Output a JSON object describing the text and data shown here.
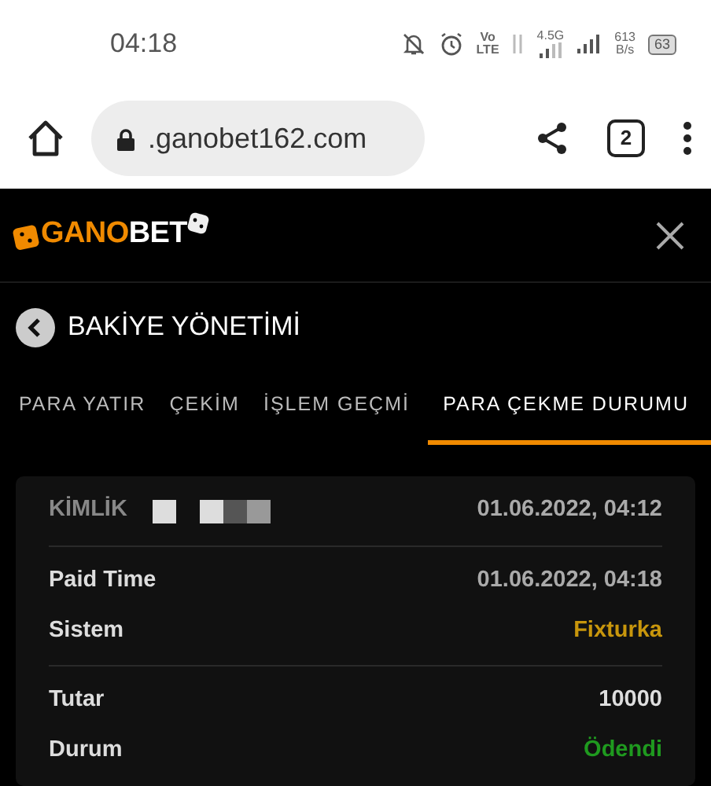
{
  "status_bar": {
    "time": "04:18",
    "volte": [
      "Vo",
      "LTE"
    ],
    "network": "4.5G",
    "speed": [
      "613",
      "B/s"
    ],
    "battery": "63"
  },
  "browser": {
    "url": ".ganobet162.com",
    "tab_count": "2"
  },
  "header": {
    "logo": [
      "GANO",
      "BET"
    ]
  },
  "page_title": "BAKİYE YÖNETİMİ",
  "tabs": [
    {
      "label": "PARA YATIR",
      "selected": false
    },
    {
      "label": "ÇEKİM",
      "selected": false
    },
    {
      "label": "İŞLEM GEÇMİ",
      "selected": false
    },
    {
      "label": "PARA ÇEKME DURUMU",
      "selected": true
    }
  ],
  "record": {
    "id_label": "KİMLİK",
    "date": "01.06.2022, 04:12",
    "sections": [
      [
        {
          "label": "Paid Time",
          "value": "01.06.2022, 04:18",
          "kind": "muted"
        },
        {
          "label": "Sistem",
          "value": "Fixturka",
          "kind": "colored",
          "color": "#c8960c"
        }
      ],
      [
        {
          "label": "Tutar",
          "value": "10000",
          "kind": "plain"
        },
        {
          "label": "Durum",
          "value": "Ödendi",
          "kind": "colored",
          "color": "#1f9a1f"
        }
      ]
    ]
  }
}
